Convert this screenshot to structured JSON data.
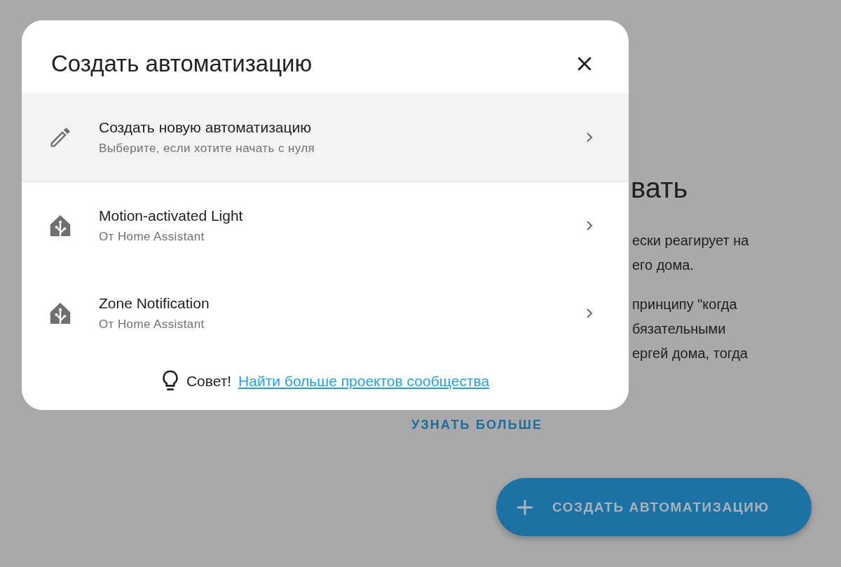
{
  "background": {
    "heading": "вать",
    "paragraphs": [
      [
        "ески реагирует на",
        "его дома."
      ],
      [
        "принципу \"когда",
        "бязательными",
        "ергей дома, тогда"
      ]
    ],
    "learn_more": "УЗНАТЬ БОЛЬШЕ",
    "fab": "СОЗДАТЬ АВТОМАТИЗАЦИЮ"
  },
  "dialog": {
    "title": "Создать автоматизацию",
    "items": [
      {
        "kind": "new",
        "title": "Создать новую автоматизацию",
        "subtitle": "Выберите, если хотите начать с нуля",
        "selected": true
      },
      {
        "kind": "blueprint",
        "title": "Motion-activated Light",
        "subtitle": "От Home Assistant",
        "selected": false
      },
      {
        "kind": "blueprint",
        "title": "Zone Notification",
        "subtitle": "От Home Assistant",
        "selected": false
      }
    ],
    "tip": {
      "label": "Совет!",
      "link": "Найти больше проектов сообщества"
    }
  }
}
